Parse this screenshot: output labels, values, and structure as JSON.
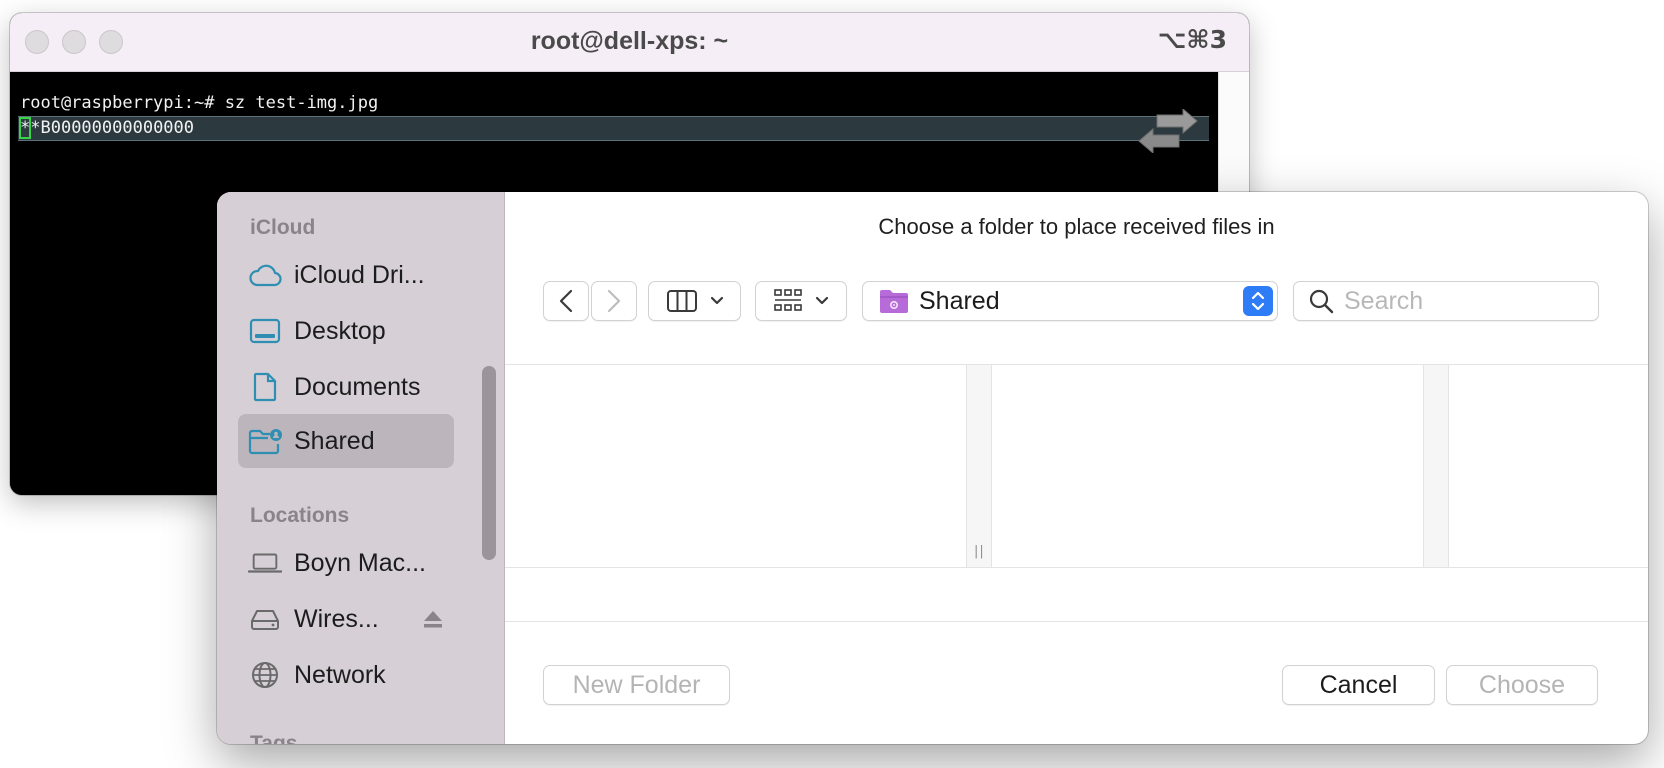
{
  "terminal": {
    "title": "root@dell-xps: ~",
    "shortcut": "⌥⌘3",
    "line1": "root@raspberrypi:~# sz test-img.jpg",
    "line2_cursor": "*",
    "line2_rest": "*B00000000000000"
  },
  "dialog": {
    "title": "Choose a folder to place received files in",
    "path": "Shared",
    "search_placeholder": "Search",
    "new_folder_label": "New Folder",
    "cancel_label": "Cancel",
    "choose_label": "Choose"
  },
  "sidebar": {
    "section_icloud": "iCloud",
    "section_locations": "Locations",
    "section_tags_partial": "Tags",
    "items": [
      {
        "label": "iCloud Dri...",
        "icon": "cloud-icon"
      },
      {
        "label": "Desktop",
        "icon": "desktop-icon"
      },
      {
        "label": "Documents",
        "icon": "document-icon"
      },
      {
        "label": "Shared",
        "icon": "shared-folder-icon"
      }
    ],
    "locations": [
      {
        "label": "Boyn Mac...",
        "icon": "laptop-icon"
      },
      {
        "label": "Wires...",
        "icon": "drive-icon"
      },
      {
        "label": "Network",
        "icon": "globe-icon"
      }
    ]
  },
  "colors": {
    "accent": "#2e7cf6",
    "sidebar_bg": "#d6cfd6",
    "icon_teal": "#2f8fb3",
    "folder_purple": "#b66bd9"
  }
}
